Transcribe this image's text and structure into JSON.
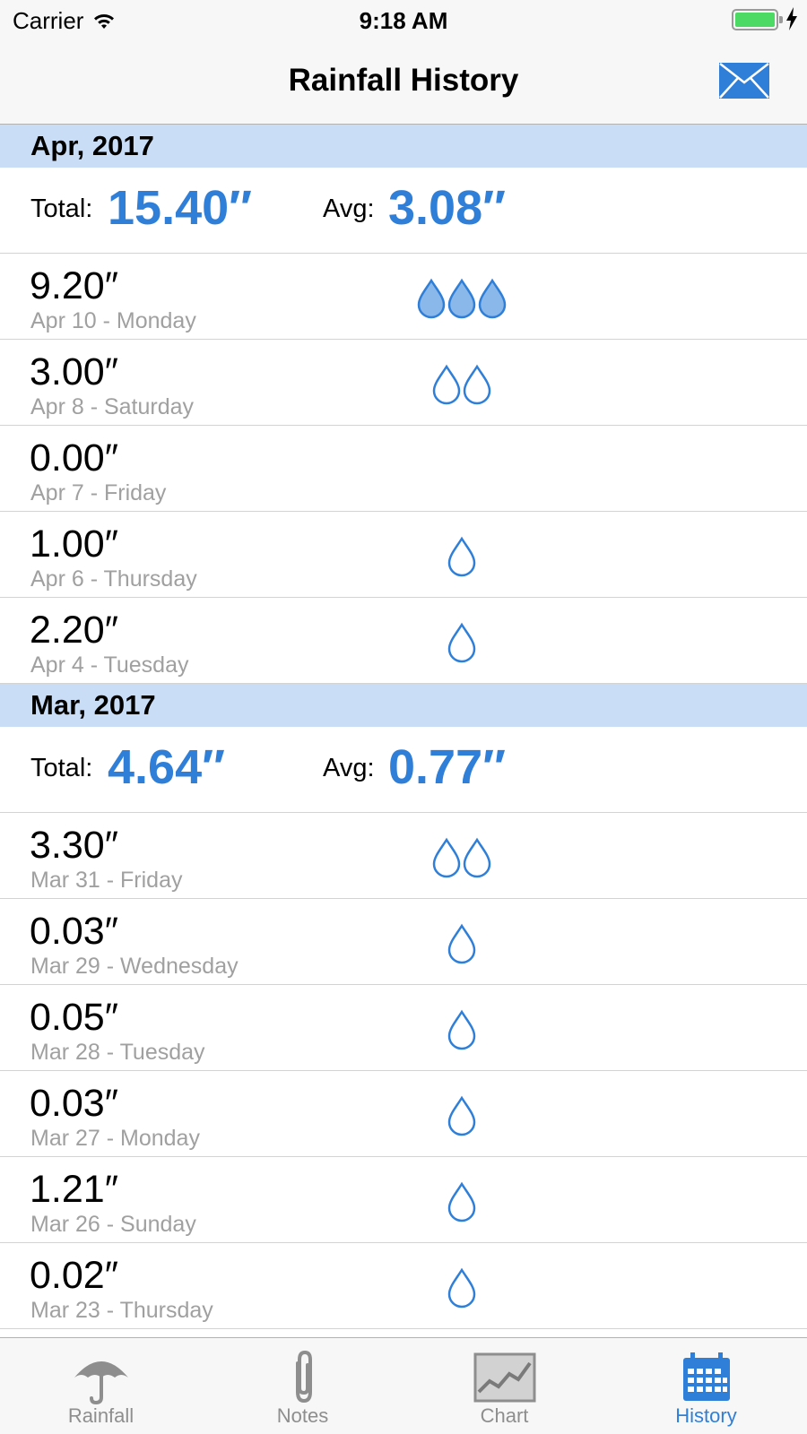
{
  "status_bar": {
    "carrier": "Carrier",
    "time": "9:18 AM"
  },
  "nav": {
    "title": "Rainfall History"
  },
  "colors": {
    "accent": "#2f7fd8",
    "section_bg": "#c9ddf6",
    "drop_fill": "#8ab8ea",
    "battery": "#4cd964"
  },
  "sections": [
    {
      "month": "Apr, 2017",
      "total_label": "Total:",
      "total_value": "15.40″",
      "avg_label": "Avg:",
      "avg_value": "3.08″",
      "days": [
        {
          "amount": "9.20″",
          "date": "Apr 10 - Monday",
          "drops": 3,
          "filled": true
        },
        {
          "amount": "3.00″",
          "date": "Apr 8 - Saturday",
          "drops": 2,
          "filled": false
        },
        {
          "amount": "0.00″",
          "date": "Apr 7 - Friday",
          "drops": 0,
          "filled": false
        },
        {
          "amount": "1.00″",
          "date": "Apr 6 - Thursday",
          "drops": 1,
          "filled": false
        },
        {
          "amount": "2.20″",
          "date": "Apr 4 - Tuesday",
          "drops": 1,
          "filled": false
        }
      ]
    },
    {
      "month": "Mar, 2017",
      "total_label": "Total:",
      "total_value": "4.64″",
      "avg_label": "Avg:",
      "avg_value": "0.77″",
      "days": [
        {
          "amount": "3.30″",
          "date": "Mar 31 - Friday",
          "drops": 2,
          "filled": false
        },
        {
          "amount": "0.03″",
          "date": "Mar 29 - Wednesday",
          "drops": 1,
          "filled": false
        },
        {
          "amount": "0.05″",
          "date": "Mar 28 - Tuesday",
          "drops": 1,
          "filled": false
        },
        {
          "amount": "0.03″",
          "date": "Mar 27 - Monday",
          "drops": 1,
          "filled": false
        },
        {
          "amount": "1.21″",
          "date": "Mar 26 - Sunday",
          "drops": 1,
          "filled": false
        },
        {
          "amount": "0.02″",
          "date": "Mar 23 - Thursday",
          "drops": 1,
          "filled": false
        }
      ]
    }
  ],
  "tabs": [
    {
      "label": "Rainfall",
      "icon": "umbrella-icon",
      "active": false
    },
    {
      "label": "Notes",
      "icon": "paperclip-icon",
      "active": false
    },
    {
      "label": "Chart",
      "icon": "chart-icon",
      "active": false
    },
    {
      "label": "History",
      "icon": "calendar-icon",
      "active": true
    }
  ]
}
